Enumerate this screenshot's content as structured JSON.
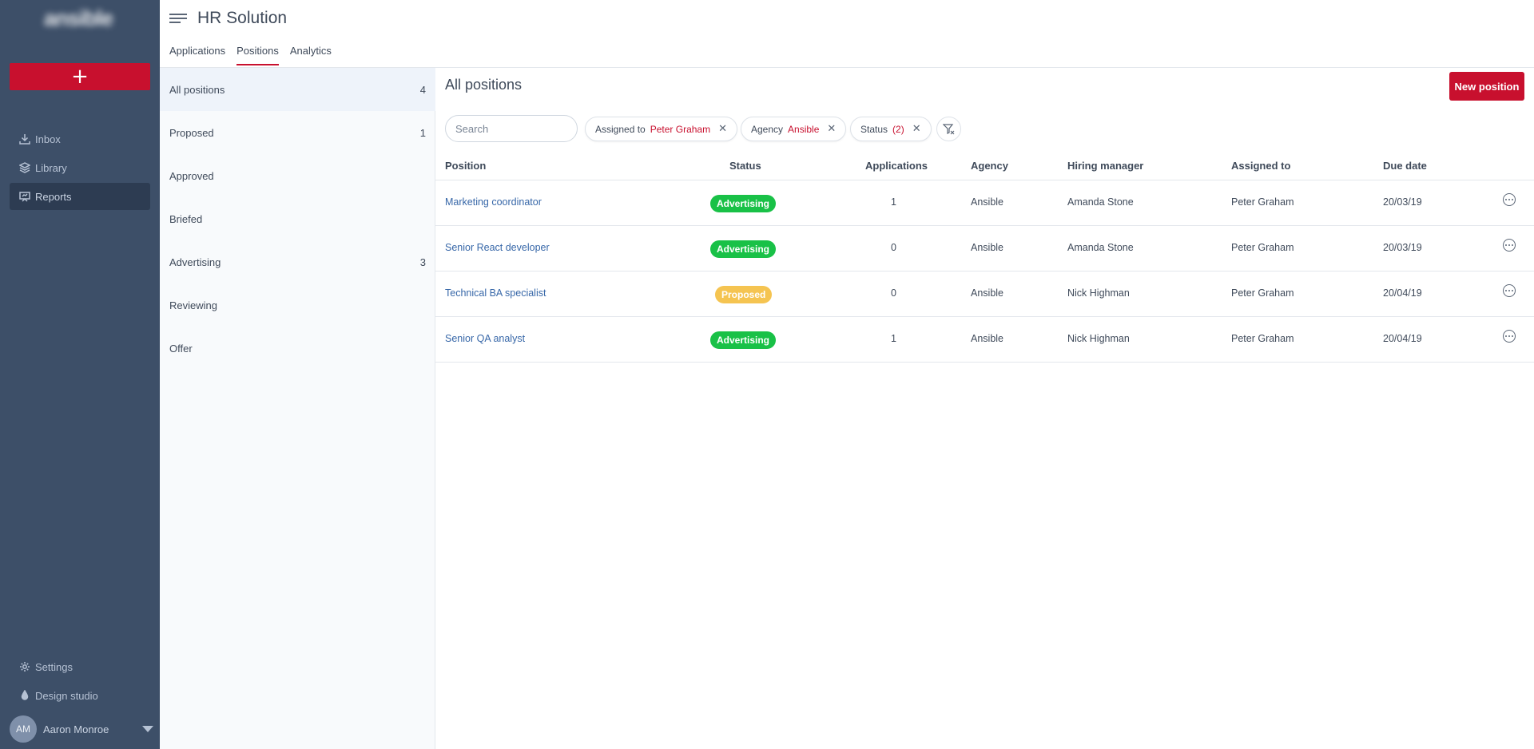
{
  "sidebar": {
    "logo_text": "ansible",
    "add_button_label": "+",
    "nav": [
      {
        "label": "Inbox",
        "icon": "download-icon"
      },
      {
        "label": "Library",
        "icon": "layers-icon"
      },
      {
        "label": "Reports",
        "icon": "presentation-icon",
        "active": true
      }
    ],
    "bottom_nav": [
      {
        "label": "Settings",
        "icon": "gear-icon"
      },
      {
        "label": "Design studio",
        "icon": "drop-icon"
      }
    ],
    "user": {
      "initials": "AM",
      "name": "Aaron Monroe"
    }
  },
  "header": {
    "title": "HR Solution",
    "tabs": [
      "Applications",
      "Positions",
      "Analytics"
    ],
    "active_tab": "Positions"
  },
  "list": {
    "items": [
      {
        "label": "All positions",
        "count": "4",
        "active": true
      },
      {
        "label": "Proposed",
        "count": "1"
      },
      {
        "label": "Approved",
        "count": ""
      },
      {
        "label": "Briefed",
        "count": ""
      },
      {
        "label": "Advertising",
        "count": "3"
      },
      {
        "label": "Reviewing",
        "count": ""
      },
      {
        "label": "Offer",
        "count": ""
      }
    ]
  },
  "main": {
    "title": "All positions",
    "new_button": "New position",
    "search_placeholder": "Search",
    "filters": [
      {
        "label": "Assigned to",
        "value": "Peter Graham"
      },
      {
        "label": "Agency",
        "value": "Ansible"
      },
      {
        "label": "Status",
        "value": "(2)"
      }
    ],
    "columns": [
      "Position",
      "Status",
      "Applications",
      "Agency",
      "Hiring manager",
      "Assigned to",
      "Due date"
    ],
    "rows": [
      {
        "position": "Marketing coordinator",
        "status": "Advertising",
        "applications": "1",
        "agency": "Ansible",
        "hiring_manager": "Amanda Stone",
        "assigned_to": "Peter Graham",
        "due": "20/03/19"
      },
      {
        "position": "Senior React developer",
        "status": "Advertising",
        "applications": "0",
        "agency": "Ansible",
        "hiring_manager": "Amanda Stone",
        "assigned_to": "Peter Graham",
        "due": "20/03/19"
      },
      {
        "position": "Technical BA specialist",
        "status": "Proposed",
        "applications": "0",
        "agency": "Ansible",
        "hiring_manager": "Nick Highman",
        "assigned_to": "Peter Graham",
        "due": "20/04/19"
      },
      {
        "position": "Senior QA analyst",
        "status": "Advertising",
        "applications": "1",
        "agency": "Ansible",
        "hiring_manager": "Nick Highman",
        "assigned_to": "Peter Graham",
        "due": "20/04/19"
      }
    ]
  },
  "colors": {
    "sidebar": "#3d4f68",
    "accent": "#c8102e",
    "advertising": "#19c147",
    "proposed": "#f5c451",
    "link": "#3767a8"
  }
}
